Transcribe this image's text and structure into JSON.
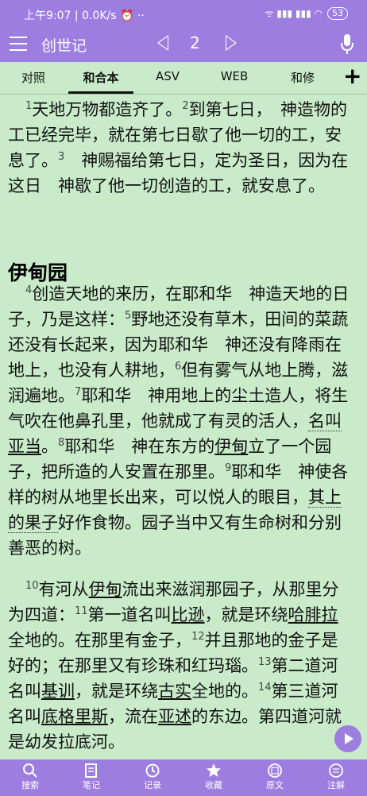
{
  "status_bar": {
    "time": "上午9:07",
    "speed": "0.0K/s",
    "icons": "⏰ ··",
    "signal": "ᯤ ▮▮▮ ▮▮▮ ◠",
    "battery": "53"
  },
  "appbar": {
    "title": "创世记",
    "chapter": "2"
  },
  "tabs": [
    "对照",
    "和合本",
    "ASV",
    "WEB",
    "和修"
  ],
  "active_tab": "和合本",
  "add_symbol": "+",
  "heading": "伊甸园",
  "verses": {
    "v1": "1",
    "t1": "天地万物都造齐了。",
    "v2": "2",
    "t2": "到第七日，　神造物的工已经完毕，就在第七日歇了他一切的工，安息了。",
    "v3": "3",
    "t3": "　神赐福给第七日，定为圣日，因为在这日　神歇了他一切创造的工，就安息了。",
    "v4": "4",
    "t4": "创造天地的来历，在耶和华　神造天地的日子，乃是这样：",
    "v5": "5",
    "t5": "野地还没有草木，田间的菜蔬还没有长起来，因为耶和华　神还没有降雨在地上，也没有人耕地，",
    "v6": "6",
    "t6": "但有雾气从地上腾，滋润遍地。",
    "v7": "7",
    "t7a": "耶和华　神用地上的尘土造人，将生气吹在他鼻孔里，他就成了有灵的活人，",
    "t7b": "名叫",
    "t7c": "亚当",
    "t7d": "。",
    "v8": "8",
    "t8a": "耶和华　神在东方的",
    "t8b": "伊甸",
    "t8c": "立了一个园子，把所造的人安置在那里。",
    "v9": "9",
    "t9a": "耶和华　神使各样的树从地里长出来，可以悦人的眼目，",
    "t9b": "其上的果子",
    "t9c": "好作食物。园子当中又有生命树和分别善恶的树。",
    "v10": "10",
    "t10a": "有河从",
    "t10b": "伊甸",
    "t10c": "流出来滋润那园子，从那里分为四道：",
    "v11": "11",
    "t11a": "第一道名叫",
    "t11b": "比逊",
    "t11c": "，就是环绕",
    "t11d": "哈腓拉",
    "t11e": "全地的。在那里有金子，",
    "v12": "12",
    "t12": "并且那地的金子是好的；在那里又有珍珠和红玛瑙。",
    "v13": "13",
    "t13a": "第二道河名叫",
    "t13b": "基训",
    "t13c": "，就是环绕",
    "t13d": "古实",
    "t13e": "全地的。",
    "v14": "14",
    "t14a": "第三道河名叫",
    "t14b": "底格里斯",
    "t14c": "，流在",
    "t14d": "亚述",
    "t14e": "的东边。第四道河就是幼发拉底河。"
  },
  "bottom_nav": [
    "搜索",
    "笔记",
    "记录",
    "收藏",
    "原文",
    "注解"
  ]
}
